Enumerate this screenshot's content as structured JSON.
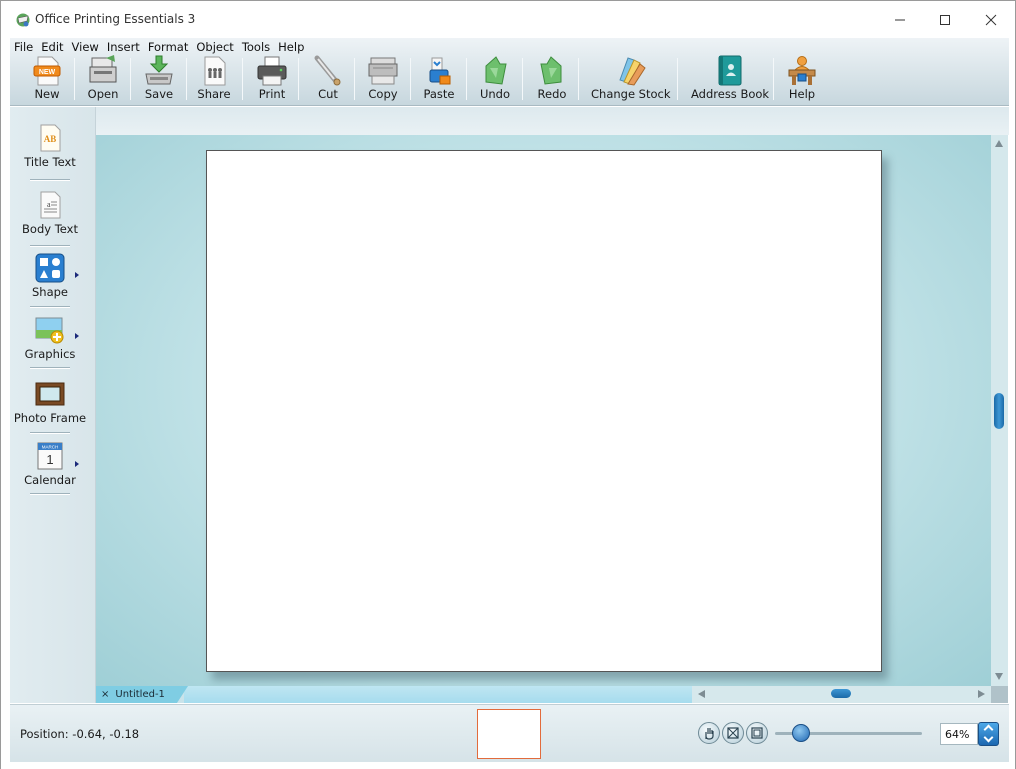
{
  "window": {
    "title": "Office Printing Essentials 3",
    "minimize": "—",
    "maximize": "☐",
    "close": "✕"
  },
  "menu": [
    "File",
    "Edit",
    "View",
    "Insert",
    "Format",
    "Object",
    "Tools",
    "Help"
  ],
  "toolbar": {
    "new": "New",
    "open": "Open",
    "save": "Save",
    "share": "Share",
    "print": "Print",
    "cut": "Cut",
    "copy": "Copy",
    "paste": "Paste",
    "undo": "Undo",
    "redo": "Redo",
    "change_stock": "Change Stock",
    "address_book": "Address Book",
    "help": "Help",
    "new_badge": "NEW"
  },
  "sidebar": {
    "title_text": "Title Text",
    "body_text": "Body Text",
    "shape": "Shape",
    "graphics": "Graphics",
    "photo_frame": "Photo Frame",
    "calendar": "Calendar",
    "title_icon_text": "AB",
    "calendar_month": "MARCH",
    "calendar_day": "1"
  },
  "document": {
    "tab_label": "Untitled-1",
    "tab_close": "×"
  },
  "status": {
    "position": "Position: -0.64, -0.18",
    "zoom": "64%"
  },
  "colors": {
    "accent_blue": "#1b6aa8",
    "thumbnail_border": "#e26b3c",
    "canvas_bg": "#bfe1e6"
  }
}
